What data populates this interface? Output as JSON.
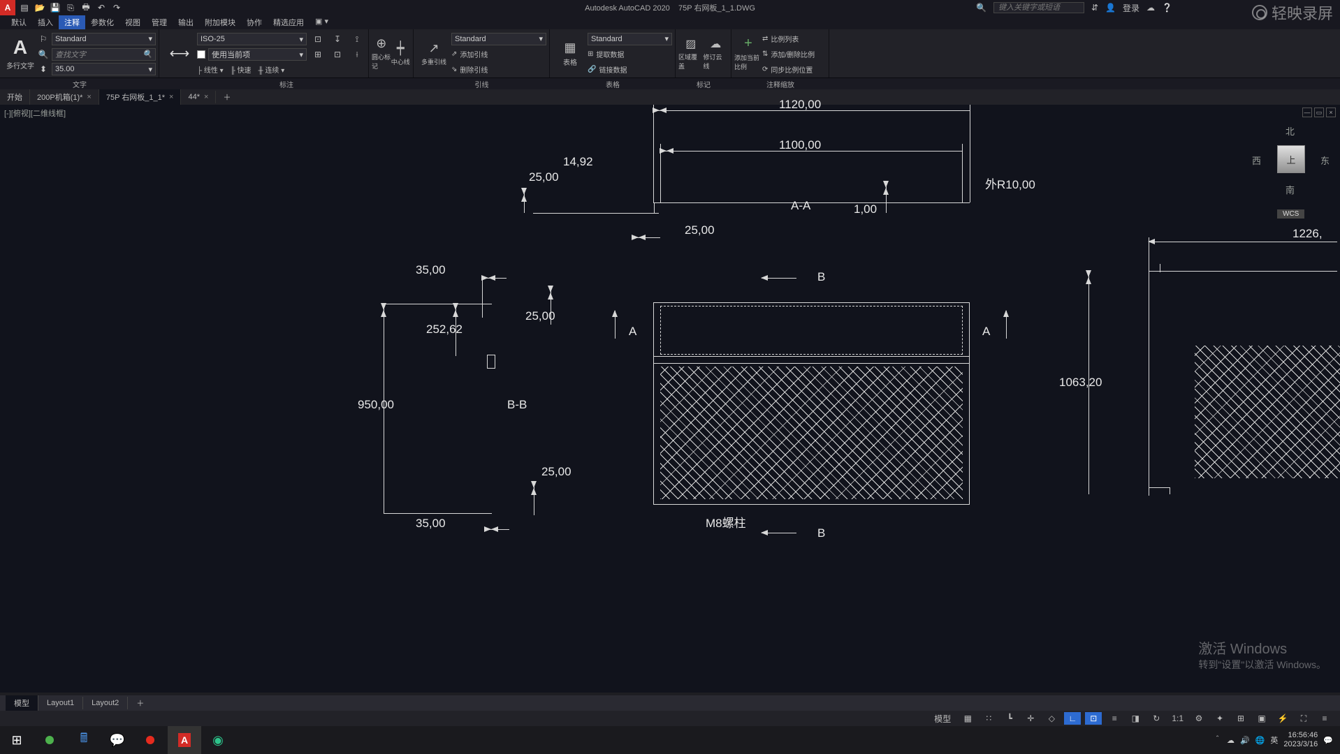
{
  "app": {
    "title_app": "Autodesk AutoCAD 2020",
    "title_file": "75P 右网板_1_1.DWG",
    "search_placeholder": "键入关键字或短语",
    "login": "登录"
  },
  "menu": {
    "items": [
      "默认",
      "插入",
      "注释",
      "参数化",
      "视图",
      "管理",
      "输出",
      "附加模块",
      "协作",
      "精选应用"
    ]
  },
  "ribbon": {
    "text": {
      "multiline_text": "多行文字",
      "find_placeholder": "查找文字",
      "style_name": "Standard",
      "height": "35.00",
      "panel_label": "文字"
    },
    "dim": {
      "style": "ISO-25",
      "use_layer": "使用当前项",
      "linear": "线性",
      "quick": "快速",
      "continue": "连续",
      "btn1": "圆心标记",
      "btn2": "中心线",
      "panel_label": "标注"
    },
    "leader": {
      "style": "Standard",
      "add_leader": "添加引线",
      "remove_leader": "删除引线",
      "multi_leader": "多重引线",
      "panel_label": "引线"
    },
    "table": {
      "style": "Standard",
      "extract": "提取数据",
      "link": "链接数据",
      "table": "表格",
      "panel_label": "表格"
    },
    "markup": {
      "b1": "区域覆盖",
      "b2": "修订云线",
      "panel_label": "标记"
    },
    "annoscale": {
      "add": "添加当前比例",
      "list": "比例列表",
      "adddelete": "添加/删除比例",
      "sync": "同步比例位置",
      "panel_label": "注释缩放"
    }
  },
  "filetabs": {
    "start": "开始",
    "tabs": [
      {
        "name": "200P机箱(1)*"
      },
      {
        "name": "75P 右网板_1_1*"
      },
      {
        "name": "44*"
      }
    ]
  },
  "viewport": {
    "label": "[-][俯视][二维线框]",
    "viewcube": {
      "n": "北",
      "e": "东",
      "s": "南",
      "w": "西",
      "top": "上",
      "wcs": "WCS"
    }
  },
  "drawing": {
    "dims": {
      "d1120": "1120,00",
      "d1100": "1100,00",
      "r1492": "14,92",
      "d25a": "25,00",
      "d100": "1,00",
      "r10": "外R10,00",
      "aa": "A-A",
      "d25b": "25,00",
      "d35a": "35,00",
      "d25c": "25,00",
      "d25262": "252,62",
      "d950": "950,00",
      "bb": "B-B",
      "d25d": "25,00",
      "d35b": "35,00",
      "m8": "M8螺柱",
      "a1": "A",
      "a2": "A",
      "b1": "B",
      "b2": "B",
      "d1063": "1063,20",
      "d1226": "1226,"
    }
  },
  "layouts": [
    "模型",
    "Layout1",
    "Layout2"
  ],
  "statusbar": {
    "model": "模型",
    "scale": "1:1"
  },
  "watermark": {
    "line1": "激活 Windows",
    "line2": "转到\"设置\"以激活 Windows。"
  },
  "brand": "轻映录屏",
  "taskbar": {
    "ime": "英",
    "time": "16:56:46",
    "date": "2023/3/16"
  }
}
